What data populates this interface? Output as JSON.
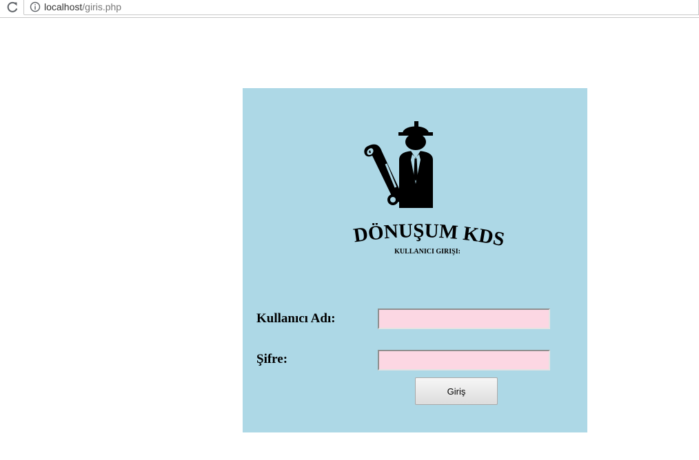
{
  "browser": {
    "url_host": "localhost",
    "url_path": "/giris.php"
  },
  "login": {
    "brand_title": "DÖNÜŞÜM KDS",
    "subtitle": "KULLANICI GIRIŞI:",
    "username_label": "Kullanıcı Adı:",
    "username_value": "",
    "password_label": "Şifre:",
    "password_value": "",
    "submit_label": "Giriş"
  },
  "colors": {
    "panel_bg": "#add8e6",
    "input_bg": "#fcd7e3"
  },
  "icons": {
    "reload": "reload-icon",
    "info": "info-icon",
    "logo": "engineer-with-blueprint-logo"
  }
}
